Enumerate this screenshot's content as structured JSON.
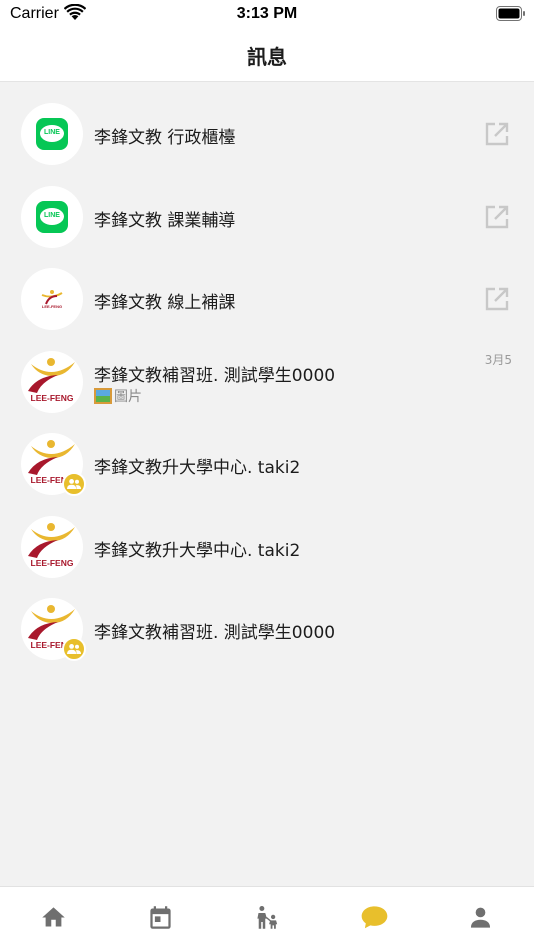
{
  "status_bar": {
    "carrier": "Carrier",
    "time": "3:13 PM",
    "wifi_icon": "wifi-icon",
    "battery_icon": "battery-icon"
  },
  "nav": {
    "title": "訊息"
  },
  "conversations": [
    {
      "title": "李鋒文教 行政櫃檯",
      "avatar": "line-logo-icon",
      "action_icon": "external-link-icon"
    },
    {
      "title": "李鋒文教 課業輔導",
      "avatar": "line-logo-icon",
      "action_icon": "external-link-icon"
    },
    {
      "title": "李鋒文教 線上補課",
      "avatar": "lee-feng-logo-icon",
      "avatar_text": "LEE-FENG",
      "action_icon": "external-link-icon"
    },
    {
      "title": "李鋒文教補習班.  測試學生0000",
      "subtitle": "圖片",
      "subtitle_icon": "picture-icon",
      "date": "3月5",
      "avatar": "lee-feng-logo-icon",
      "avatar_text": "LEE-FENG"
    },
    {
      "title": "李鋒文教升大學中心.  taki2",
      "avatar": "lee-feng-logo-icon",
      "avatar_text": "LEE-FENG",
      "badge_icon": "group-icon"
    },
    {
      "title": "李鋒文教升大學中心.  taki2",
      "avatar": "lee-feng-logo-icon",
      "avatar_text": "LEE-FENG"
    },
    {
      "title": "李鋒文教補習班.  測試學生0000",
      "avatar": "lee-feng-logo-icon",
      "avatar_text": "LEE-FENG",
      "badge_icon": "group-icon"
    }
  ],
  "line_badge_text": "LINE",
  "tab_bar": {
    "tabs": [
      {
        "name": "home",
        "icon": "home-icon",
        "active": false
      },
      {
        "name": "calendar",
        "icon": "calendar-icon",
        "active": false
      },
      {
        "name": "family",
        "icon": "parent-child-icon",
        "active": false
      },
      {
        "name": "messages",
        "icon": "chat-bubble-icon",
        "active": true
      },
      {
        "name": "profile",
        "icon": "person-icon",
        "active": false
      }
    ]
  },
  "colors": {
    "accent": "#e8bf2c",
    "line_green": "#06c755",
    "logo_red": "#a8182c",
    "logo_yellow": "#e9b730",
    "tab_inactive": "#6f6f6f",
    "background": "#f2f2f2"
  }
}
